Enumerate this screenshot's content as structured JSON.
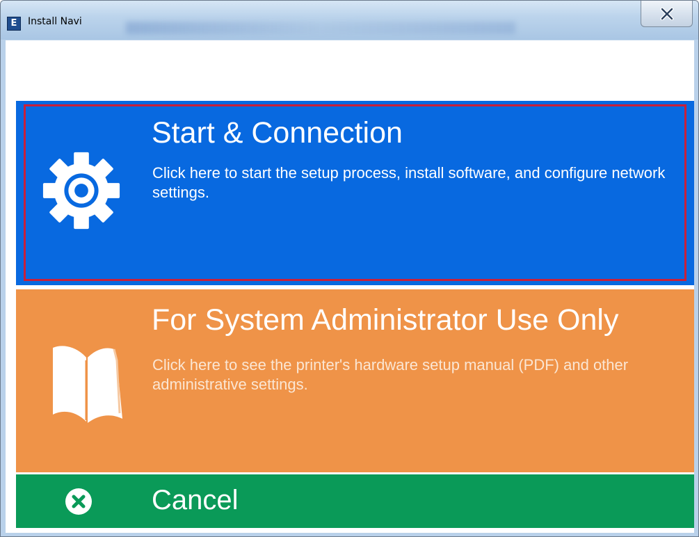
{
  "window": {
    "title": "Install Navi",
    "app_icon_letter": "E",
    "close_label": "X"
  },
  "panels": {
    "start": {
      "title": "Start & Connection",
      "description": "Click here to start the setup process, install software, and configure network settings.",
      "icon": "gear-icon",
      "color": "#0869e0",
      "highlighted": true,
      "highlight_color": "#c8203a"
    },
    "admin": {
      "title": "For System Administrator Use Only",
      "description": "Click here to see the printer's hardware setup manual (PDF) and other administrative settings.",
      "icon": "book-icon",
      "color": "#ef9348"
    },
    "cancel": {
      "title": "Cancel",
      "icon": "cancel-icon",
      "color": "#0a9a58"
    }
  }
}
